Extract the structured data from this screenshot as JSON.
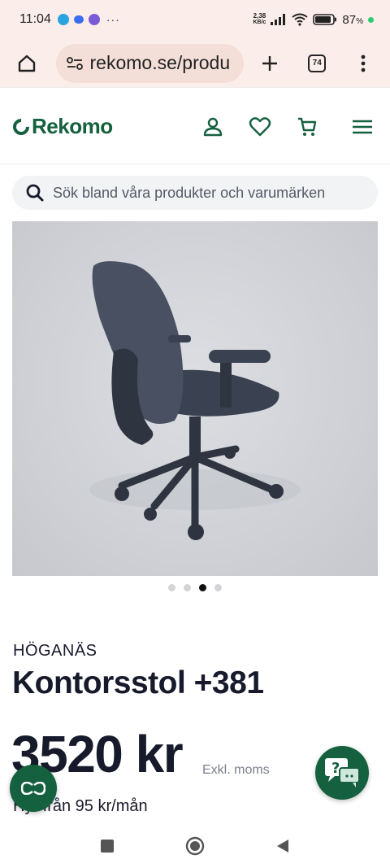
{
  "status_bar": {
    "time": "11:04",
    "dots": "···",
    "speed_value": "2,38",
    "speed_unit": "KB/c",
    "battery": "87",
    "battery_unit": "%"
  },
  "browser": {
    "url": "rekomo.se/produ",
    "tabs_count": "74"
  },
  "site": {
    "logo_text": "Rekomo",
    "brand_color": "#14603f",
    "search_placeholder": "Sök bland våra produkter och varumärken"
  },
  "product": {
    "brand": "HÖGANÄS",
    "title": "Kontorsstol +381",
    "price": "3520 kr",
    "price_note": "Exkl. moms",
    "rent": "Hyr från 95 kr/mån",
    "carousel": {
      "count": 4,
      "active_index": 2
    }
  },
  "icons": {
    "home": "home-icon",
    "site_settings": "site-settings-icon",
    "new_tab": "plus-icon",
    "tabs": "tabs-icon",
    "more": "more-vertical-icon",
    "account": "user-icon",
    "favorites": "heart-icon",
    "cart": "cart-icon",
    "menu": "menu-icon",
    "search": "search-icon",
    "chat": "chat-help-icon"
  }
}
